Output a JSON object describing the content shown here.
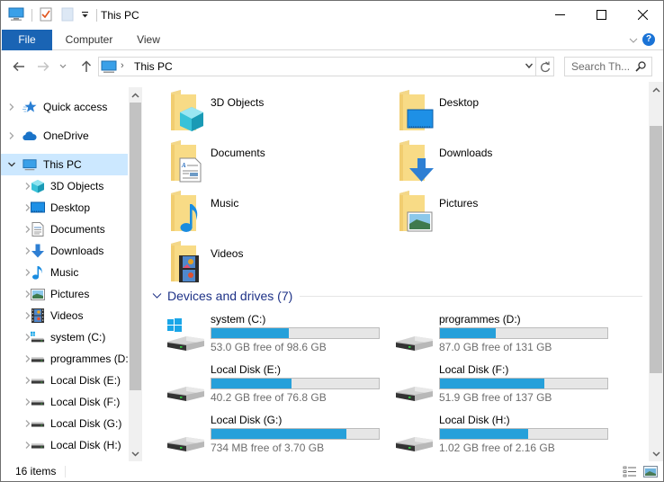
{
  "window": {
    "title": "This PC",
    "controls": {
      "minimize": "minimize",
      "maximize": "maximize",
      "close": "close"
    }
  },
  "ribbon": {
    "tabs": [
      {
        "label": "File",
        "active": true
      },
      {
        "label": "Computer"
      },
      {
        "label": "View"
      }
    ],
    "help_label": "?"
  },
  "address_bar": {
    "path": [
      "This PC"
    ],
    "search_placeholder": "Search Th..."
  },
  "nav_pane": {
    "items": [
      {
        "label": "Quick access",
        "icon": "star-icon",
        "level": 0,
        "expanded": false
      },
      {
        "label": "OneDrive",
        "icon": "cloud-icon",
        "level": 0,
        "expanded": false
      },
      {
        "label": "This PC",
        "icon": "computer-icon",
        "level": 0,
        "expanded": true,
        "selected": true
      },
      {
        "label": "3D Objects",
        "icon": "cube-icon",
        "level": 1
      },
      {
        "label": "Desktop",
        "icon": "desktop-icon",
        "level": 1
      },
      {
        "label": "Documents",
        "icon": "document-icon",
        "level": 1
      },
      {
        "label": "Downloads",
        "icon": "download-arrow-icon",
        "level": 1
      },
      {
        "label": "Music",
        "icon": "music-note-icon",
        "level": 1
      },
      {
        "label": "Pictures",
        "icon": "picture-icon",
        "level": 1
      },
      {
        "label": "Videos",
        "icon": "film-icon",
        "level": 1
      },
      {
        "label": "system (C:)",
        "icon": "system-drive-icon",
        "level": 1
      },
      {
        "label": "programmes (D:",
        "icon": "drive-icon",
        "level": 1
      },
      {
        "label": "Local Disk (E:)",
        "icon": "drive-icon",
        "level": 1
      },
      {
        "label": "Local Disk (F:)",
        "icon": "drive-icon",
        "level": 1
      },
      {
        "label": "Local Disk (G:)",
        "icon": "drive-icon",
        "level": 1
      },
      {
        "label": "Local Disk (H:)",
        "icon": "drive-icon",
        "level": 1
      }
    ]
  },
  "content": {
    "folders": [
      {
        "name": "3D Objects",
        "overlay": "cube"
      },
      {
        "name": "Desktop",
        "overlay": "desktop"
      },
      {
        "name": "Documents",
        "overlay": "document"
      },
      {
        "name": "Downloads",
        "overlay": "download"
      },
      {
        "name": "Music",
        "overlay": "music"
      },
      {
        "name": "Pictures",
        "overlay": "picture"
      },
      {
        "name": "Videos",
        "overlay": "film"
      }
    ],
    "drives_group": {
      "title": "Devices and drives (7)"
    },
    "drives": [
      {
        "name": "system (C:)",
        "free_text": "53.0 GB free of 98.6 GB",
        "used_fraction": 0.462,
        "system": true
      },
      {
        "name": "programmes (D:)",
        "free_text": "87.0 GB free of 131 GB",
        "used_fraction": 0.336
      },
      {
        "name": "Local Disk (E:)",
        "free_text": "40.2 GB free of 76.8 GB",
        "used_fraction": 0.477
      },
      {
        "name": "Local Disk (F:)",
        "free_text": "51.9 GB free of 137 GB",
        "used_fraction": 0.621
      },
      {
        "name": "Local Disk (G:)",
        "free_text": "734 MB free of 3.70 GB",
        "used_fraction": 0.806
      },
      {
        "name": "Local Disk (H:)",
        "free_text": "1.02 GB free of 2.16 GB",
        "used_fraction": 0.528
      }
    ]
  },
  "status_bar": {
    "item_count": "16 items"
  },
  "colors": {
    "accent": "#1a64b4",
    "selection": "#cce8ff",
    "bar_fill": "#26a0da",
    "group_title": "#1e3287"
  }
}
